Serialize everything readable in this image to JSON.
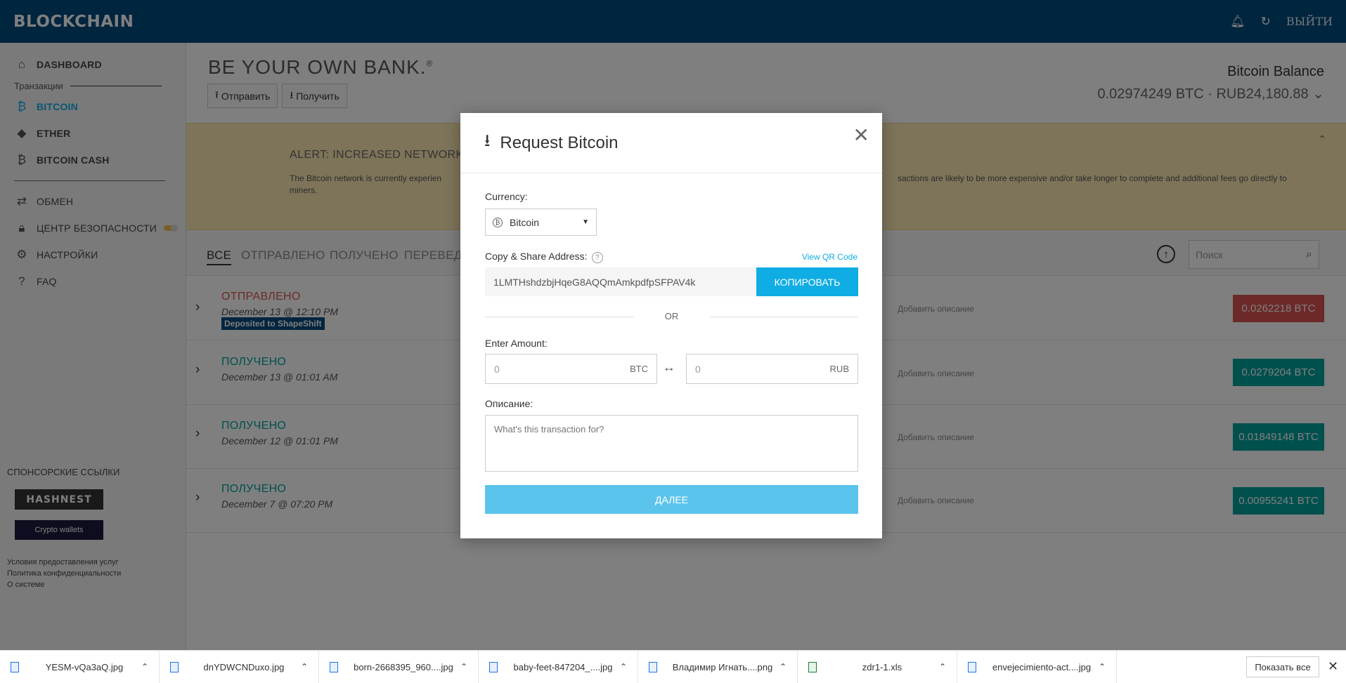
{
  "topbar": {
    "logo": "BLOCKCHAIN",
    "logout": "ВЫЙТИ"
  },
  "sidebar": {
    "dashboard": "DASHBOARD",
    "transactions_label": "Транзакции",
    "bitcoin": "BITCOIN",
    "ether": "ETHER",
    "bitcoin_cash": "BITCOIN CASH",
    "exchange": "ОБМЕН",
    "security": "ЦЕНТР БЕЗОПАСНОСТИ",
    "settings": "НАСТРОЙКИ",
    "faq": "FAQ",
    "sponsor_label": "СПОНСОРСКИЕ ССЫЛКИ",
    "sponsor1": "HASHNEST",
    "sponsor2": "Crypto wallets",
    "links": [
      "Условия предоставления услуг",
      "Политика конфиденциальности",
      "О системе"
    ]
  },
  "main": {
    "hero": "BE YOUR OWN BANK.",
    "hero_mark": "®",
    "send": "Отправить",
    "receive": "Получить",
    "balance_label": "Bitcoin Balance",
    "balance_value": "0.02974249 BTC · RUB24,180.88",
    "alert_title": "ALERT: INCREASED NETWORK",
    "alert_text_left": "The Bitcoin network is currently experien",
    "alert_text_right": "sactions are likely to be more expensive and/or take longer to complete and additional fees go directly to",
    "alert_text_end": "miners.",
    "tabs": [
      "ВСЕ",
      "ОТПРАВЛЕНО",
      "ПОЛУЧЕНО",
      "ПЕРЕВЕДЕ"
    ],
    "search_placeholder": "Поиск",
    "desc_placeholder": "Добавить описание",
    "transactions": [
      {
        "status": "ОТПРАВЛЕНО",
        "date": "December 13 @ 12:10 PM",
        "badge": "Deposited to ShapeShift",
        "amount": "0.0262218 BTC"
      },
      {
        "status": "ПОЛУЧЕНО",
        "date": "December 13 @ 01:01 AM",
        "amount": "0.0279204 BTC"
      },
      {
        "status": "ПОЛУЧЕНО",
        "date": "December 12 @ 01:01 PM",
        "amount": "0.01849148 BTC"
      },
      {
        "status": "ПОЛУЧЕНО",
        "date": "December 7 @ 07:20 PM",
        "amount": "0.00955241 BTC"
      }
    ]
  },
  "modal": {
    "title": "Request Bitcoin",
    "currency_label": "Currency:",
    "currency_value": "Bitcoin",
    "address_label": "Copy & Share Address:",
    "qr_link": "View QR Code",
    "address": "1LMTHshdzbjHqeG8AQQmAmkpdfpSFPAV4k",
    "copy_button": "КОПИРОВАТЬ",
    "or": "OR",
    "amount_label": "Enter Amount:",
    "btc_value": "0",
    "btc_unit": "BTC",
    "rub_value": "0",
    "rub_unit": "RUB",
    "description_label": "Описание:",
    "description_placeholder": "What's this transaction for?",
    "next_button": "ДАЛЕЕ"
  },
  "downloads": {
    "files": [
      {
        "name": "YESM-vQa3aQ.jpg",
        "type": "image"
      },
      {
        "name": "dnYDWCNDuxo.jpg",
        "type": "image"
      },
      {
        "name": "born-2668395_960....jpg",
        "type": "image"
      },
      {
        "name": "baby-feet-847204_....jpg",
        "type": "image"
      },
      {
        "name": "Владимир Игнать....png",
        "type": "image"
      },
      {
        "name": "zdr1-1.xls",
        "type": "spreadsheet"
      },
      {
        "name": "envejecimiento-act....jpg",
        "type": "image"
      }
    ],
    "show_all": "Показать все"
  },
  "colors": {
    "topbar": "#004a7c",
    "accent": "#10ade4",
    "sent": "#d9534f",
    "received": "#00a09d",
    "alert_bg": "#fbe9b2"
  }
}
